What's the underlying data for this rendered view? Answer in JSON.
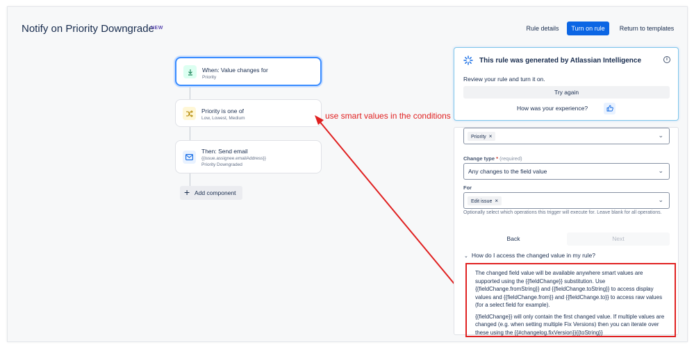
{
  "header": {
    "title": "Notify on Priority Downgrade",
    "badge": "NEW",
    "rule_details": "Rule details",
    "turn_on": "Turn on rule",
    "return": "Return to templates"
  },
  "flow": {
    "nodes": [
      {
        "title": "When: Value changes for",
        "sub1": "Priority",
        "sub2": "",
        "icon": "download-icon"
      },
      {
        "title": "Priority is one of",
        "sub1": "Low, Lowest, Medium",
        "sub2": "",
        "icon": "shuffle-icon"
      },
      {
        "title": "Then: Send email",
        "sub1": "{{issue.assignee.emailAddress}}",
        "sub2": "Priority Downgraded",
        "icon": "mail-icon"
      }
    ],
    "add_component": "Add component"
  },
  "annotation": {
    "text": "use smart values in the conditions",
    "color": "#e02020"
  },
  "ai_panel": {
    "title": "This rule was generated by Atlassian Intelligence",
    "review": "Review your rule and turn it on.",
    "try_again": "Try again",
    "experience": "How was your experience?"
  },
  "config": {
    "field_chip": "Priority",
    "change_type_label": "Change type",
    "required_text": "(required)",
    "change_type_value": "Any changes to the field value",
    "for_label": "For",
    "for_chip": "Edit issue",
    "help": "Optionally select which operations this trigger will execute for. Leave blank for all operations.",
    "back": "Back",
    "next": "Next",
    "howdo": "How do I access the changed value in my rule?",
    "explain_p1": "The changed field value will be available anywhere smart values are supported using the {{fieldChange}} substitution. Use {{fieldChange.fromString}} and {{fieldChange.toString}} to access display values and {{fieldChange.from}} and {{fieldChange.to}} to access raw values (for a select field for example).",
    "explain_p2": "{{fieldChange}} will only contain the first changed value. If multiple values are changed (e.g. when setting multiple Fix Versions) then you can iterate over these using the {{#changelog.fixVersion}}{{toString}}"
  },
  "colors": {
    "primary": "#0c66e4",
    "annotation_red": "#e02020",
    "selected_border": "#388bff"
  }
}
